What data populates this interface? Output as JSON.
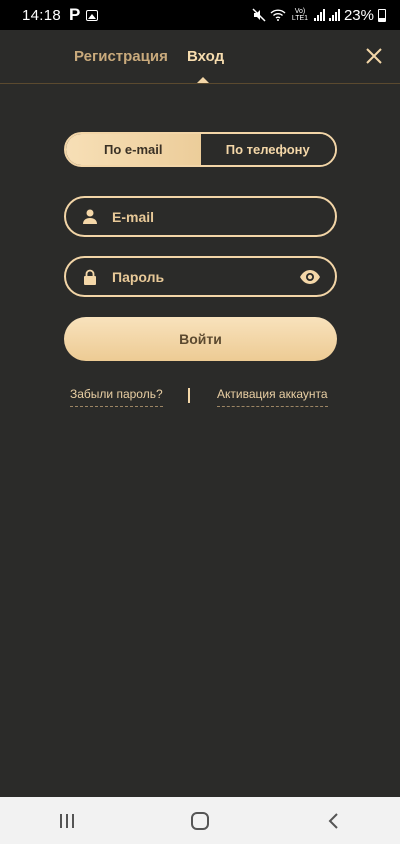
{
  "status_bar": {
    "time": "14:18",
    "app_letter": "P",
    "network_label": "Vo) LTE1",
    "battery": "23%",
    "icons": [
      "p-icon",
      "image-icon",
      "mute-icon",
      "wifi-icon",
      "signal-icon",
      "battery-icon"
    ]
  },
  "header": {
    "tabs": [
      {
        "label": "Регистрация",
        "active": false
      },
      {
        "label": "Вход",
        "active": true
      }
    ],
    "close_icon": "close-icon"
  },
  "login_method": {
    "options": [
      {
        "label": "По e-mail",
        "selected": true
      },
      {
        "label": "По телефону",
        "selected": false
      }
    ]
  },
  "form": {
    "email": {
      "placeholder": "E-mail",
      "icon": "user-icon"
    },
    "password": {
      "placeholder": "Пароль",
      "icon": "lock-icon",
      "toggle_icon": "eye-icon"
    },
    "submit_label": "Войти"
  },
  "links": {
    "forgot": "Забыли пароль?",
    "activate": "Активация аккаунта"
  },
  "navigation": {
    "buttons": [
      "recent-apps-icon",
      "home-icon",
      "back-icon"
    ]
  },
  "colors": {
    "background": "#2b2b29",
    "accent": "#f4d7a8",
    "status_bar": "#000000",
    "nav_bar": "#f2f2f2"
  }
}
